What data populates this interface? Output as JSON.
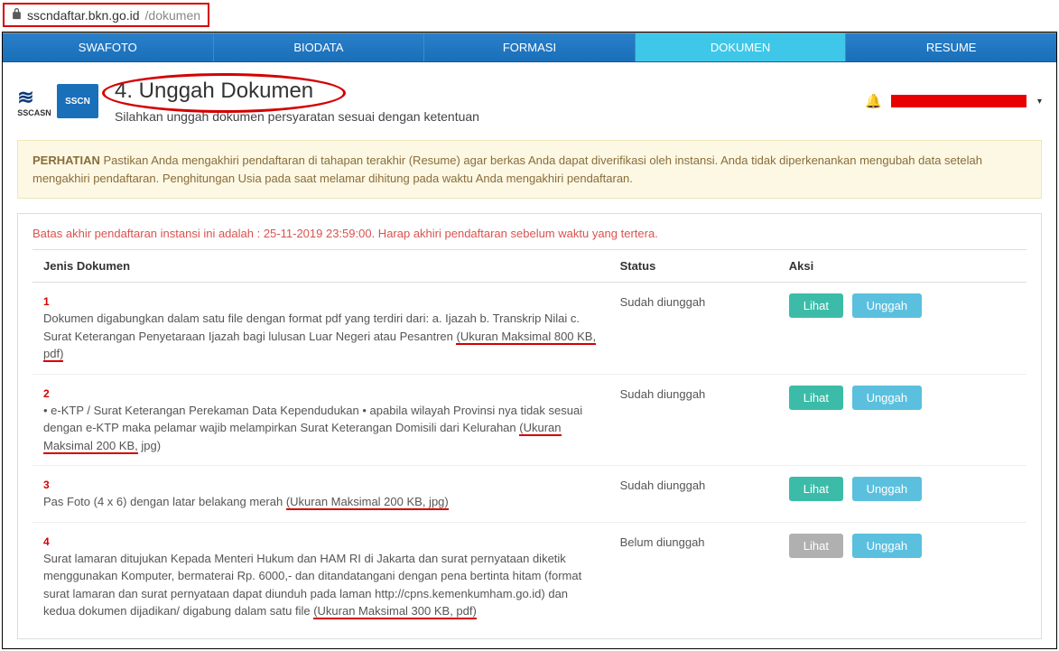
{
  "url": {
    "domain": "sscndaftar.bkn.go.id",
    "path": "/dokumen"
  },
  "nav": {
    "tabs": [
      "SWAFOTO",
      "BIODATA",
      "FORMASI",
      "DOKUMEN",
      "RESUME"
    ],
    "active_index": 3
  },
  "logos": {
    "logo1_text": "SSCASN",
    "logo2_text": "SSCN"
  },
  "page": {
    "title": "4. Unggah Dokumen",
    "subtitle": "Silahkan unggah dokumen persyaratan sesuai dengan ketentuan"
  },
  "alert": {
    "label": "PERHATIAN",
    "text": "Pastikan Anda mengakhiri pendaftaran di tahapan terakhir (Resume) agar berkas Anda dapat diverifikasi oleh instansi. Anda tidak diperkenankan mengubah data setelah mengakhiri pendaftaran. Penghitungan Usia pada saat melamar dihitung pada waktu Anda mengakhiri pendaftaran."
  },
  "deadline": "Batas akhir pendaftaran instansi ini adalah : 25-11-2019 23:59:00. Harap akhiri pendaftaran sebelum waktu yang tertera.",
  "table": {
    "headers": {
      "doc": "Jenis Dokumen",
      "status": "Status",
      "aksi": "Aksi"
    },
    "buttons": {
      "lihat": "Lihat",
      "unggah": "Unggah"
    },
    "rows": [
      {
        "num": "1",
        "desc_pre": "Dokumen digabungkan dalam satu file dengan format pdf yang terdiri dari: a. Ijazah b. Transkrip Nilai c. Surat Keterangan Penyetaraan Ijazah bagi lulusan Luar Negeri atau Pesantren ",
        "desc_underlined": "(Ukuran Maksimal 800 KB, pdf)",
        "status": "Sudah diunggah",
        "lihat_enabled": true
      },
      {
        "num": "2",
        "desc_pre": "• e-KTP / Surat Keterangan Perekaman Data Kependudukan • apabila wilayah Provinsi nya tidak sesuai dengan e-KTP maka pelamar wajib melampirkan Surat Keterangan Domisili dari Kelurahan ",
        "desc_underlined": "(Ukuran Maksimal 200 KB,",
        "desc_post": " jpg)",
        "status": "Sudah diunggah",
        "lihat_enabled": true
      },
      {
        "num": "3",
        "desc_pre": "Pas Foto (4 x 6) dengan latar belakang merah ",
        "desc_underlined": "(Ukuran Maksimal 200 KB, jpg)",
        "status": "Sudah diunggah",
        "lihat_enabled": true
      },
      {
        "num": "4",
        "desc_pre": "Surat lamaran ditujukan Kepada Menteri Hukum dan HAM RI di Jakarta dan surat pernyataan diketik menggunakan Komputer, bermaterai Rp. 6000,- dan ditandatangani dengan pena bertinta hitam (format surat lamaran dan surat pernyataan dapat diunduh pada laman http://cpns.kemenkumham.go.id) dan kedua dokumen dijadikan/ digabung dalam satu file ",
        "desc_underlined": "(Ukuran Maksimal 300 KB, pdf)",
        "status": "Belum diunggah",
        "lihat_enabled": false
      }
    ]
  }
}
